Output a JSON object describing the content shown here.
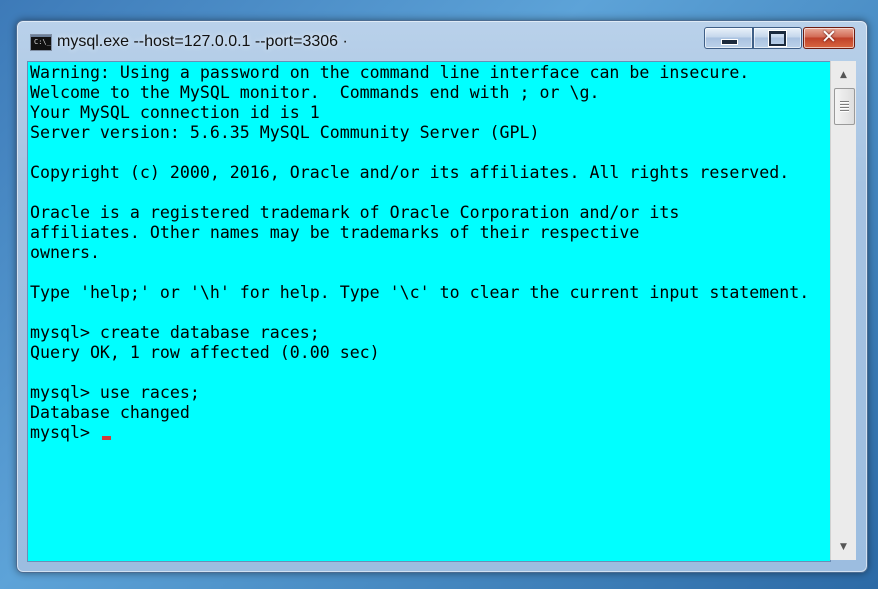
{
  "window": {
    "title": "mysql.exe  --host=127.0.0.1 --port=3306 ·",
    "icon": "console-app-icon",
    "icon_glyph": "C:\\_"
  },
  "controls": {
    "minimize_icon": "minimize-icon",
    "maximize_icon": "maximize-icon",
    "close_icon": "close-icon",
    "close_glyph": "✕"
  },
  "console": {
    "background_color": "#00ffff",
    "text_color": "#000000",
    "cursor_color": "#d23b3b",
    "lines": [
      "Warning: Using a password on the command line interface can be insecure.",
      "Welcome to the MySQL monitor.  Commands end with ; or \\g.",
      "Your MySQL connection id is 1",
      "Server version: 5.6.35 MySQL Community Server (GPL)",
      "",
      "Copyright (c) 2000, 2016, Oracle and/or its affiliates. All rights reserved.",
      "",
      "Oracle is a registered trademark of Oracle Corporation and/or its",
      "affiliates. Other names may be trademarks of their respective",
      "owners.",
      "",
      "Type 'help;' or '\\h' for help. Type '\\c' to clear the current input statement.",
      "",
      "mysql> create database races;",
      "Query OK, 1 row affected (0.00 sec)",
      "",
      "mysql> use races;",
      "Database changed"
    ],
    "prompt": "mysql> "
  },
  "scrollbar": {
    "up_arrow": "▲",
    "down_arrow": "▼",
    "up_icon": "scroll-up-arrow-icon",
    "down_icon": "scroll-down-arrow-icon"
  }
}
